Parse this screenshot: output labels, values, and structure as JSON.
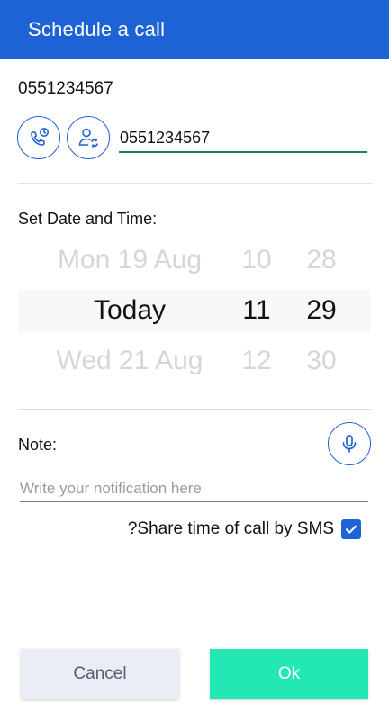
{
  "app_bar": {
    "title": "Schedule a call"
  },
  "contact": {
    "number": "0551234567"
  },
  "phone_field": {
    "value": "0551234567"
  },
  "icons": {
    "call": "phone-schedule-icon",
    "contact": "contact-sync-icon",
    "mic": "microphone-icon",
    "check": "checkmark-icon"
  },
  "datetime": {
    "label": "Set Date and Time:",
    "date": {
      "prev": "Mon 19 Aug",
      "selected": "Today",
      "next": "Wed 21 Aug"
    },
    "hour": {
      "prev": "10",
      "selected": "11",
      "next": "12"
    },
    "minute": {
      "prev": "28",
      "selected": "29",
      "next": "30"
    }
  },
  "note": {
    "label": "Note:",
    "placeholder": "Write your notification here",
    "value": ""
  },
  "sms": {
    "label": "?Share time of call by SMS",
    "checked": true
  },
  "buttons": {
    "cancel": "Cancel",
    "ok": "Ok"
  },
  "colors": {
    "primary": "#1e63d6",
    "ok_button": "#24e8b4",
    "cancel_button": "#eaedf6",
    "input_underline": "#1b7f73"
  }
}
